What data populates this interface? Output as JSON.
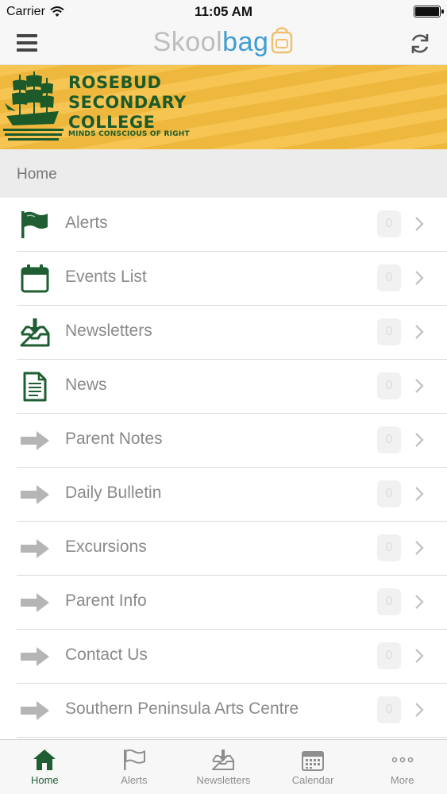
{
  "status_bar": {
    "carrier": "Carrier",
    "time": "11:05 AM"
  },
  "nav": {
    "brand_part1": "Skool",
    "brand_part2": "bag",
    "brand_icon": "backpack-icon"
  },
  "banner": {
    "line1": "ROSEBUD",
    "line2": "SECONDARY",
    "line3": "COLLEGE",
    "motto": "MINDS CONSCIOUS OF RIGHT",
    "logo_icon": "ship-icon"
  },
  "section": {
    "title": "Home"
  },
  "menu": [
    {
      "label": "Alerts",
      "icon": "flag-icon",
      "badge": "0"
    },
    {
      "label": "Events List",
      "icon": "calendar-icon",
      "badge": "0"
    },
    {
      "label": "Newsletters",
      "icon": "inbox-download-icon",
      "badge": "0"
    },
    {
      "label": "News",
      "icon": "document-icon",
      "badge": "0"
    },
    {
      "label": "Parent Notes",
      "icon": "arrow-right-icon",
      "badge": "0"
    },
    {
      "label": "Daily Bulletin",
      "icon": "arrow-right-icon",
      "badge": "0"
    },
    {
      "label": "Excursions",
      "icon": "arrow-right-icon",
      "badge": "0"
    },
    {
      "label": "Parent Info",
      "icon": "arrow-right-icon",
      "badge": "0"
    },
    {
      "label": "Contact Us",
      "icon": "arrow-right-icon",
      "badge": "0"
    },
    {
      "label": "Southern Peninsula Arts Centre",
      "icon": "arrow-right-icon",
      "badge": "0"
    }
  ],
  "tabs": [
    {
      "label": "Home",
      "icon": "home-icon",
      "active": true
    },
    {
      "label": "Alerts",
      "icon": "flag-icon",
      "active": false
    },
    {
      "label": "Newsletters",
      "icon": "inbox-download-icon",
      "active": false
    },
    {
      "label": "Calendar",
      "icon": "calendar-icon",
      "active": false
    },
    {
      "label": "More",
      "icon": "more-icon",
      "active": false
    }
  ],
  "colors": {
    "accent_green": "#1f5e32",
    "banner_yellow": "#f5be3f",
    "brand_blue": "#3f9cd4",
    "text_grey": "#8a8a8a"
  }
}
